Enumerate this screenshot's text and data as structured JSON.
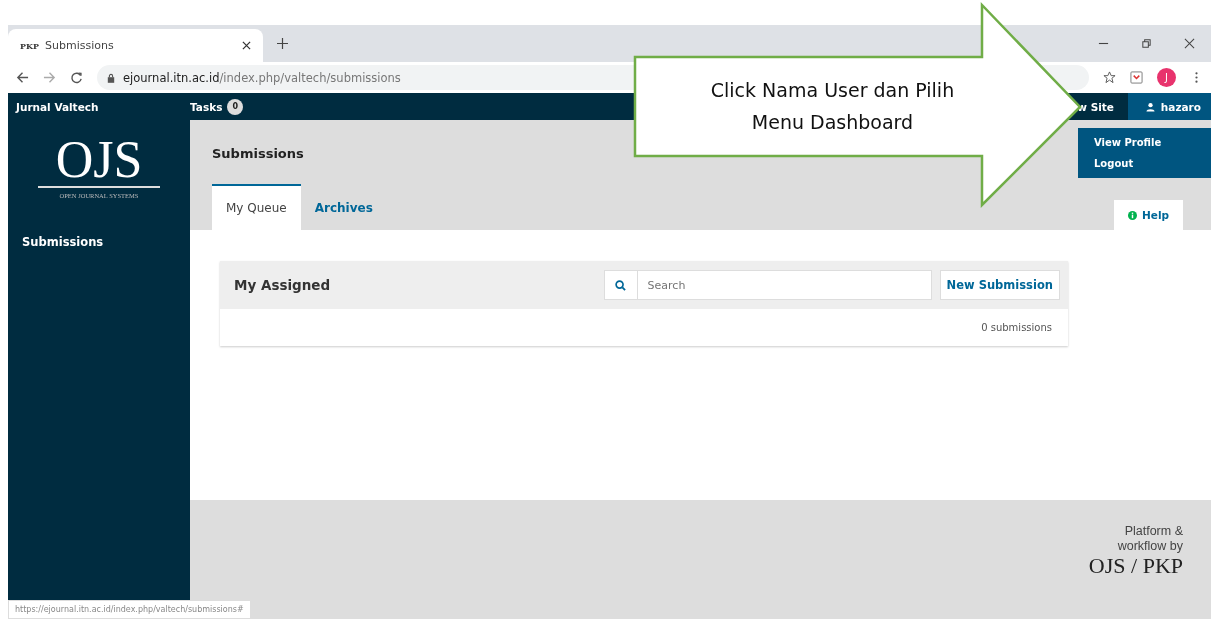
{
  "browser": {
    "tab_icon": "PKP",
    "tab_title": "Submissions",
    "url_domain": "ejournal.itn.ac.id",
    "url_path": "/index.php/valtech/submissions",
    "profile_initial": "J",
    "status_url": "https://ejournal.itn.ac.id/index.php/valtech/submissions#"
  },
  "topbar": {
    "site": "Jurnal Valtech",
    "tasks_label": "Tasks",
    "tasks_count": "0",
    "view_site": "w Site",
    "user": "hazaro"
  },
  "user_menu": [
    "View Profile",
    "Logout"
  ],
  "sidebar": {
    "logo": "OJS",
    "logo_sub": "OPEN JOURNAL SYSTEMS",
    "items": [
      {
        "label": "Submissions"
      }
    ]
  },
  "page": {
    "title": "Submissions",
    "help": "Help",
    "tabs": [
      {
        "label": "My Queue",
        "selected": true
      },
      {
        "label": "Archives",
        "selected": false
      }
    ]
  },
  "panel": {
    "title": "My Assigned",
    "search_placeholder": "Search",
    "button": "New Submission",
    "count": "0 submissions"
  },
  "footer": {
    "line1": "Platform &",
    "line2": "workflow by",
    "brand": "OJS / PKP"
  },
  "callout": {
    "text": "Click Nama User dan Pilih Menu Dashboard"
  }
}
